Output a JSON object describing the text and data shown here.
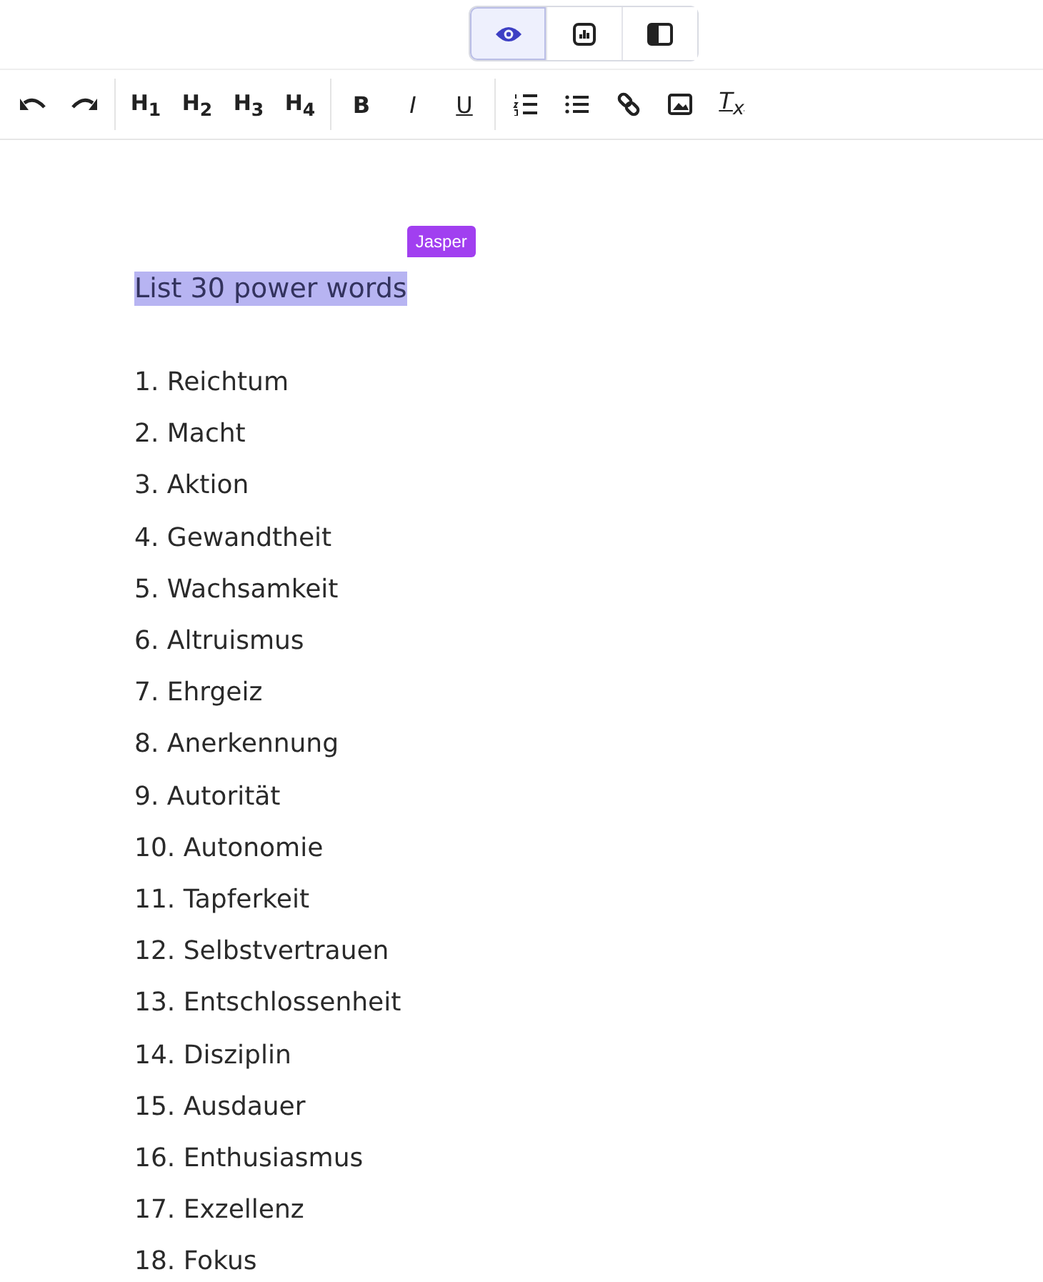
{
  "view_modes": [
    {
      "kind": "preview",
      "selected": true
    },
    {
      "kind": "stats",
      "selected": false
    },
    {
      "kind": "panel",
      "selected": false
    }
  ],
  "toolbar": {
    "groups": [
      [
        {
          "kind": "undo"
        },
        {
          "kind": "redo"
        }
      ],
      [
        {
          "kind": "text",
          "label": "H$_{1}$"
        },
        {
          "kind": "text",
          "label": "H$_{2}$"
        },
        {
          "kind": "text",
          "label": "H$_{3}$"
        },
        {
          "kind": "text",
          "label": "H$_{4}$"
        }
      ],
      [
        {
          "kind": "bold",
          "label": "B"
        },
        {
          "kind": "italic",
          "label": "I"
        },
        {
          "kind": "underline",
          "label": "U"
        }
      ],
      [
        {
          "kind": "ordered-list"
        },
        {
          "kind": "bullet-list"
        },
        {
          "kind": "link"
        },
        {
          "kind": "image"
        },
        {
          "kind": "clear-format",
          "label": "T$_{x}$"
        }
      ]
    ]
  },
  "editor": {
    "prompt": "List 30 power words",
    "prompt_selected": true,
    "author_tag": "Jasper",
    "items": [
      "1. Reichtum",
      "2. Macht",
      "3. Aktion",
      "4. Gewandtheit",
      "5. Wachsamkeit",
      "6. Altruismus",
      "7. Ehrgeiz",
      "8. Anerkennung",
      "9. Autorität",
      "10. Autonomie",
      "11. Tapferkeit",
      "12. Selbstvertrauen",
      "13. Entschlossenheit",
      "14. Disziplin",
      "15. Ausdauer",
      "16. Enthusiasmus",
      "17. Exzellenz",
      "18. Fokus"
    ]
  }
}
